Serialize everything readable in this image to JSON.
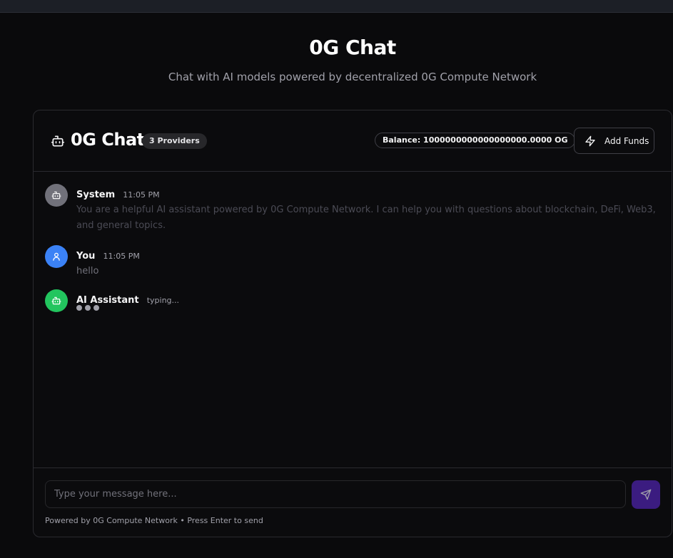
{
  "hero": {
    "title": "0G Chat",
    "subtitle": "Chat with AI models powered by decentralized 0G Compute Network"
  },
  "header": {
    "title": "0G Chat",
    "providers_badge": "3 Providers",
    "balance": "Balance: 1000000000000000000.0000 OG",
    "add_funds_label": "Add Funds",
    "icons": {
      "title": "bot-icon",
      "add_funds": "zap-icon"
    }
  },
  "messages": [
    {
      "role": "system",
      "name": "System",
      "time": "11:05 PM",
      "text": "You are a helpful AI assistant powered by 0G Compute Network. I can help you with questions about blockchain, DeFi, Web3, and general topics.",
      "avatar_icon": "bot-icon",
      "avatar_color": "#71717a"
    },
    {
      "role": "user",
      "name": "You",
      "time": "11:05 PM",
      "text": "hello",
      "avatar_icon": "user-icon",
      "avatar_color": "#3b82f6"
    },
    {
      "role": "assistant",
      "name": "AI Assistant",
      "status": "typing...",
      "avatar_icon": "bot-icon",
      "avatar_color": "#22c55e"
    }
  ],
  "composer": {
    "placeholder": "Type your message here...",
    "value": "",
    "send_icon": "send-icon",
    "send_color": "#3b1c80",
    "footer": "Powered by 0G Compute Network • Press Enter to send"
  }
}
